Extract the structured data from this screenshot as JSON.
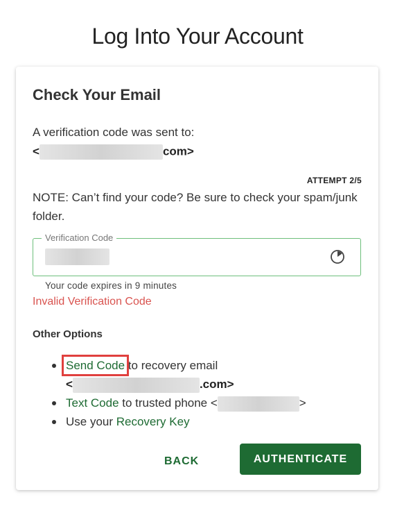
{
  "page": {
    "title": "Log Into Your Account"
  },
  "card": {
    "title": "Check Your Email",
    "sent_text": "A verification code was sent to:",
    "sent_prefix": "<",
    "sent_suffix": "com>",
    "attempt": "ATTEMPT 2/5",
    "note": "NOTE: Can’t find your code? Be sure to check your spam/junk folder."
  },
  "field": {
    "label": "Verification Code",
    "icon": "timer-icon",
    "expires": "Your code expires in 9 minutes",
    "error": "Invalid Verification Code"
  },
  "options": {
    "title": "Other Options",
    "send_code_link": "Send Code",
    "send_code_text": " to recovery email",
    "recovery_prefix": "<",
    "recovery_suffix": ".com>",
    "text_code_link": "Text Code",
    "text_code_text": " to trusted phone <",
    "text_code_suffix": ">",
    "recovery_key_prefix": "Use your ",
    "recovery_key_link": "Recovery Key"
  },
  "buttons": {
    "back": "BACK",
    "authenticate": "AUTHENTICATE"
  },
  "colors": {
    "primary": "#1e6b33",
    "error": "#d9534f",
    "field_border": "#6dbf7b",
    "highlight": "#e0403e"
  }
}
